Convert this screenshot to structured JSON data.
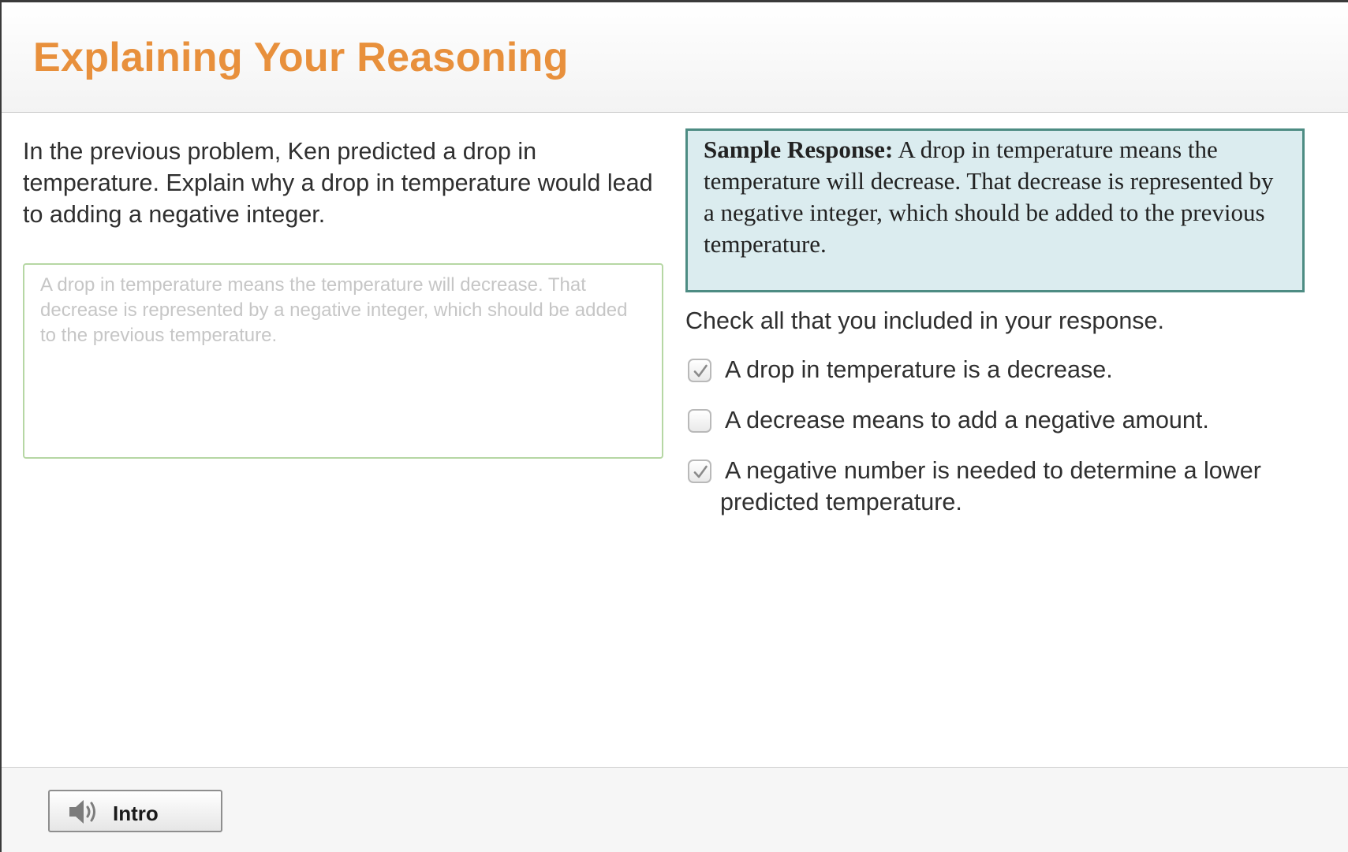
{
  "header": {
    "title": "Explaining Your Reasoning"
  },
  "prompt": {
    "text": "In the previous problem, Ken predicted a drop in temperature. Explain why a drop in temperature would lead to adding a negative integer."
  },
  "answer": {
    "value": "A drop in temperature means the temperature will decrease. That decrease is represented by a negative integer, which should be added to the previous temperature."
  },
  "sample": {
    "label": "Sample Response:",
    "text": "A drop in temperature means the temperature will decrease. That decrease is represented by a negative integer, which should be added to the previous temperature."
  },
  "checklist": {
    "instruction": "Check all that you included in your response.",
    "items": [
      {
        "label": "A drop in temperature is a decrease.",
        "checked": true
      },
      {
        "label": "A decrease means to add a negative amount.",
        "checked": false
      },
      {
        "label_line1": "A negative number is needed to determine a lower",
        "label_line2": "predicted temperature.",
        "checked": true
      }
    ]
  },
  "footer": {
    "intro_label": "Intro",
    "intro_icon": "speaker-icon"
  },
  "colors": {
    "title": "#e8903c",
    "sample_bg": "#dbecef",
    "sample_border": "#4d8c83",
    "answer_border": "#b6d7a4"
  }
}
